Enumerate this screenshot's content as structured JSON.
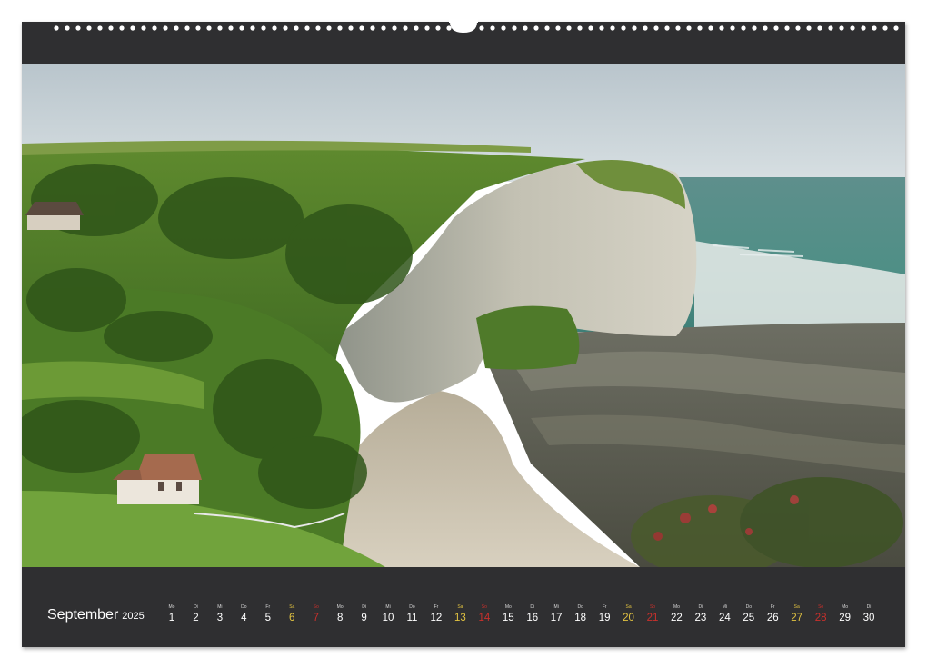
{
  "photo": {
    "subject": "chalk cliffs above a beach"
  },
  "calendar": {
    "month": "September",
    "year": "2025",
    "days": [
      {
        "wd": "Mo",
        "n": "1",
        "kind": "weekday"
      },
      {
        "wd": "Di",
        "n": "2",
        "kind": "weekday"
      },
      {
        "wd": "Mi",
        "n": "3",
        "kind": "weekday"
      },
      {
        "wd": "Do",
        "n": "4",
        "kind": "weekday"
      },
      {
        "wd": "Fr",
        "n": "5",
        "kind": "weekday"
      },
      {
        "wd": "Sa",
        "n": "6",
        "kind": "sat"
      },
      {
        "wd": "So",
        "n": "7",
        "kind": "sun"
      },
      {
        "wd": "Mo",
        "n": "8",
        "kind": "weekday"
      },
      {
        "wd": "Di",
        "n": "9",
        "kind": "weekday"
      },
      {
        "wd": "Mi",
        "n": "10",
        "kind": "weekday"
      },
      {
        "wd": "Do",
        "n": "11",
        "kind": "weekday"
      },
      {
        "wd": "Fr",
        "n": "12",
        "kind": "weekday"
      },
      {
        "wd": "Sa",
        "n": "13",
        "kind": "sat"
      },
      {
        "wd": "So",
        "n": "14",
        "kind": "sun"
      },
      {
        "wd": "Mo",
        "n": "15",
        "kind": "weekday"
      },
      {
        "wd": "Di",
        "n": "16",
        "kind": "weekday"
      },
      {
        "wd": "Mi",
        "n": "17",
        "kind": "weekday"
      },
      {
        "wd": "Do",
        "n": "18",
        "kind": "weekday"
      },
      {
        "wd": "Fr",
        "n": "19",
        "kind": "weekday"
      },
      {
        "wd": "Sa",
        "n": "20",
        "kind": "sat"
      },
      {
        "wd": "So",
        "n": "21",
        "kind": "sun"
      },
      {
        "wd": "Mo",
        "n": "22",
        "kind": "weekday"
      },
      {
        "wd": "Di",
        "n": "23",
        "kind": "weekday"
      },
      {
        "wd": "Mi",
        "n": "24",
        "kind": "weekday"
      },
      {
        "wd": "Do",
        "n": "25",
        "kind": "weekday"
      },
      {
        "wd": "Fr",
        "n": "26",
        "kind": "weekday"
      },
      {
        "wd": "Sa",
        "n": "27",
        "kind": "sat"
      },
      {
        "wd": "So",
        "n": "28",
        "kind": "sun"
      },
      {
        "wd": "Mo",
        "n": "29",
        "kind": "weekday"
      },
      {
        "wd": "Di",
        "n": "30",
        "kind": "weekday"
      }
    ]
  },
  "colors": {
    "band": "#2f2f31",
    "saturday": "#e2c341",
    "sunday": "#c9302c",
    "text": "#ffffff"
  }
}
